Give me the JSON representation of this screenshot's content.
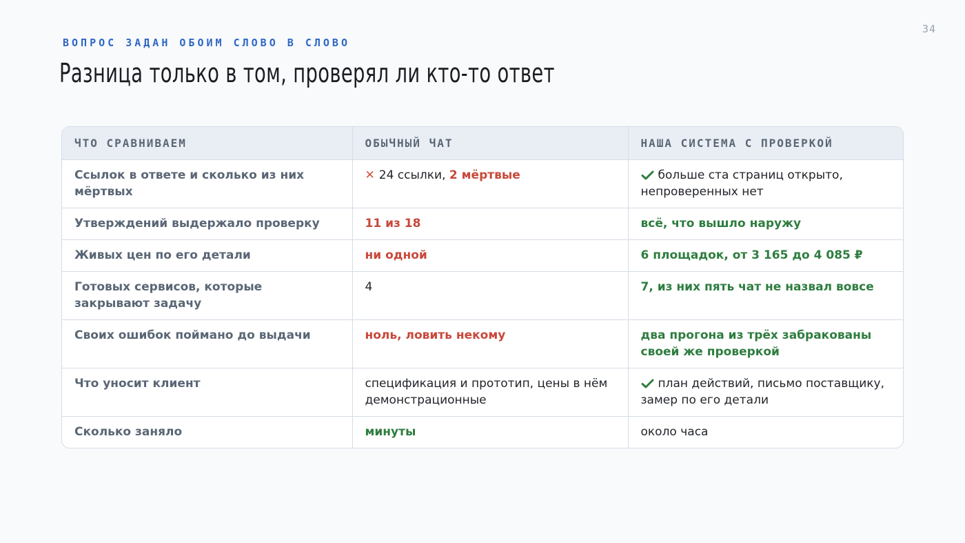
{
  "slide": {
    "page_number": "34",
    "eyebrow": "ВОПРОС ЗАДАН ОБОИМ СЛОВО В СЛОВО",
    "title": "Разница только в том, проверял ли кто-то ответ"
  },
  "table": {
    "headers": [
      "ЧТО СРАВНИВАЕМ",
      "ОБЫЧНЫЙ ЧАТ",
      "НАША СИСТЕМА С ПРОВЕРКОЙ"
    ],
    "rows": [
      {
        "label": "Ссылок в ответе и сколько из них мёртвых",
        "chat": {
          "icon": "cross-icon",
          "plain": "24 ссылки, ",
          "highlight": "2 мёртвые"
        },
        "system": {
          "icon": "check-icon",
          "plain": "больше ста страниц открыто, непроверенных нет"
        }
      },
      {
        "label": "Утверждений выдержало проверку",
        "chat": {
          "highlight": "11 из 18"
        },
        "system": {
          "highlight": "всё, что вышло наружу"
        }
      },
      {
        "label": "Живых цен по его детали",
        "chat": {
          "highlight": "ни одной"
        },
        "system": {
          "highlight": "6 площадок, от 3 165 до 4 085 ₽"
        }
      },
      {
        "label": "Готовых сервисов, которые закрывают задачу",
        "chat": {
          "plain": "4"
        },
        "system": {
          "highlight": "7, из них пять чат не назвал вовсе"
        }
      },
      {
        "label": "Своих ошибок поймано до выдачи",
        "chat": {
          "highlight": "ноль, ловить некому"
        },
        "system": {
          "highlight": "два прогона из трёх забракованы своей же проверкой"
        }
      },
      {
        "label": "Что уносит клиент",
        "chat": {
          "plain": "спецификация и прототип, цены в нём демонстрационные"
        },
        "system": {
          "icon": "check-icon",
          "plain": "план действий, письмо поставщику, замер по его детали"
        }
      },
      {
        "label": "Сколько заняло",
        "chat": {
          "highlight": "минуты"
        },
        "system": {
          "plain": "около часа"
        }
      }
    ]
  },
  "colors": {
    "accent_blue": "#2f67c4",
    "negative_red": "#c8483a",
    "positive_green": "#2e7d3f"
  }
}
